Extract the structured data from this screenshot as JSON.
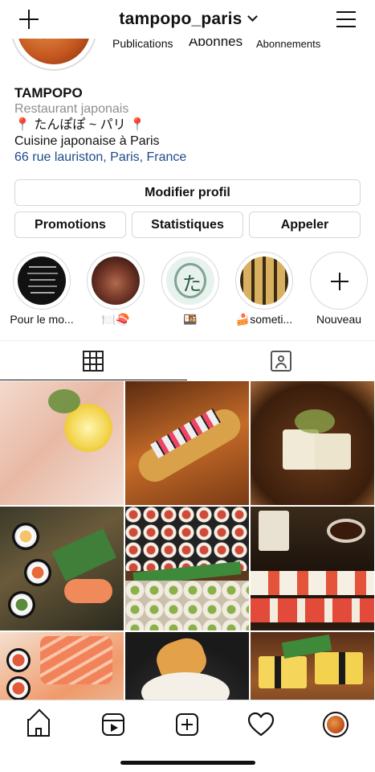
{
  "header": {
    "username": "tampopo_paris"
  },
  "stats": {
    "posts_label": "Publications",
    "followers_label": "Abonnés",
    "following_label": "Abonnements"
  },
  "bio": {
    "name": "TAMPOPO",
    "category": "Restaurant japonais",
    "line1": "📍 たんぽぽ ~ パリ 📍",
    "line2": "Cuisine japonaise à Paris",
    "address": "66 rue lauriston, Paris, France"
  },
  "buttons": {
    "edit_profile": "Modifier profil",
    "promotions": "Promotions",
    "statistics": "Statistiques",
    "call": "Appeler"
  },
  "highlights": [
    {
      "label": "Pour le mo..."
    },
    {
      "label": "🍽️🍣"
    },
    {
      "label": "🍱"
    },
    {
      "label": "🍰someti..."
    },
    {
      "label": "Nouveau"
    }
  ],
  "icons": {
    "top_left": "plus-icon",
    "top_right": "menu-icon",
    "tab_grid": "grid-icon",
    "tab_tagged": "tagged-icon",
    "nav": [
      "home-icon",
      "reels-icon",
      "new-post-icon",
      "heart-icon",
      "profile-avatar"
    ]
  }
}
